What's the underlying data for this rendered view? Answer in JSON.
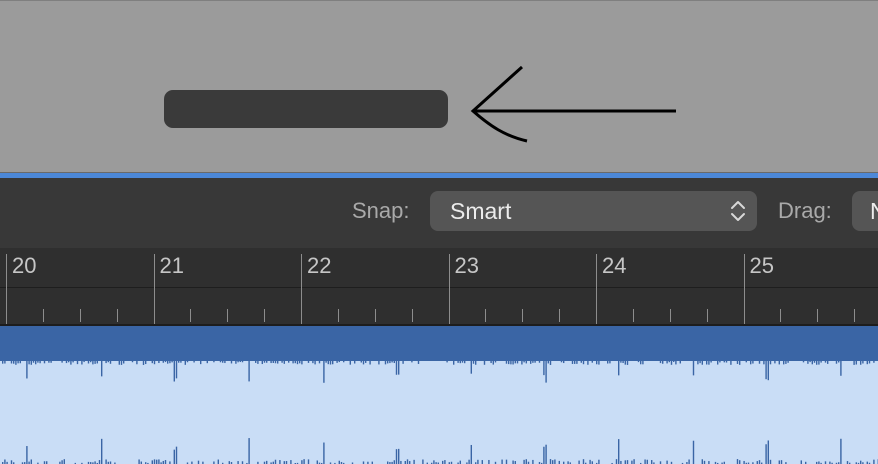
{
  "toolbar": {
    "snap_label": "Snap:",
    "snap_value": "Smart",
    "drag_label": "Drag:",
    "drag_value": "N"
  },
  "ruler": {
    "bars": [
      "20",
      "21",
      "22",
      "23",
      "24",
      "25"
    ]
  },
  "icons": {
    "snap_dropdown": "updown-chevron-icon",
    "annotation": "arrow-left-icon"
  },
  "colors": {
    "accent_blue": "#4c88d8",
    "region_header": "#3a65a5",
    "waveform_bg": "#c9ddf6",
    "toolbar_bg": "#383838",
    "ruler_bg": "#2f2f2f"
  }
}
